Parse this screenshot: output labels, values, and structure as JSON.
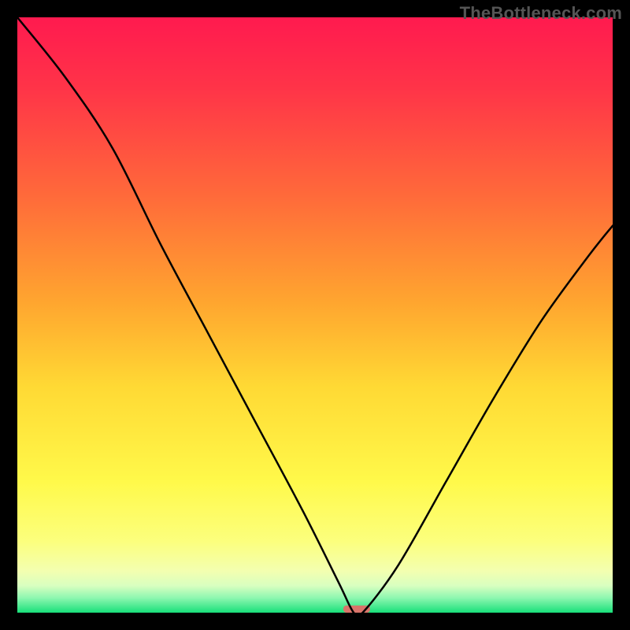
{
  "watermark": "TheBottleneck.com",
  "chart_data": {
    "type": "line",
    "title": "",
    "xlabel": "",
    "ylabel": "",
    "xlim": [
      0,
      100
    ],
    "ylim": [
      0,
      100
    ],
    "grid": false,
    "series": [
      {
        "name": "bottleneck-curve",
        "x": [
          0,
          8,
          16,
          24,
          32,
          40,
          48,
          54,
          56.5,
          58,
          64,
          72,
          80,
          88,
          96,
          100
        ],
        "y": [
          100,
          90,
          78,
          62,
          47,
          32,
          17,
          5,
          0,
          0,
          8,
          22,
          36,
          49,
          60,
          65
        ],
        "color": "#000000"
      }
    ],
    "optimum_marker": {
      "x_center": 57,
      "width": 4.5,
      "height": 1.2,
      "color": "#d9746a"
    },
    "background_gradient": {
      "stops": [
        {
          "offset": 0.0,
          "color": "#ff1a4f"
        },
        {
          "offset": 0.12,
          "color": "#ff3448"
        },
        {
          "offset": 0.3,
          "color": "#ff6a3a"
        },
        {
          "offset": 0.48,
          "color": "#ffa62f"
        },
        {
          "offset": 0.62,
          "color": "#ffd934"
        },
        {
          "offset": 0.78,
          "color": "#fff94a"
        },
        {
          "offset": 0.88,
          "color": "#fcff7d"
        },
        {
          "offset": 0.93,
          "color": "#f3ffb0"
        },
        {
          "offset": 0.955,
          "color": "#d8ffc0"
        },
        {
          "offset": 0.975,
          "color": "#8ef7b0"
        },
        {
          "offset": 1.0,
          "color": "#18e07a"
        }
      ]
    }
  }
}
